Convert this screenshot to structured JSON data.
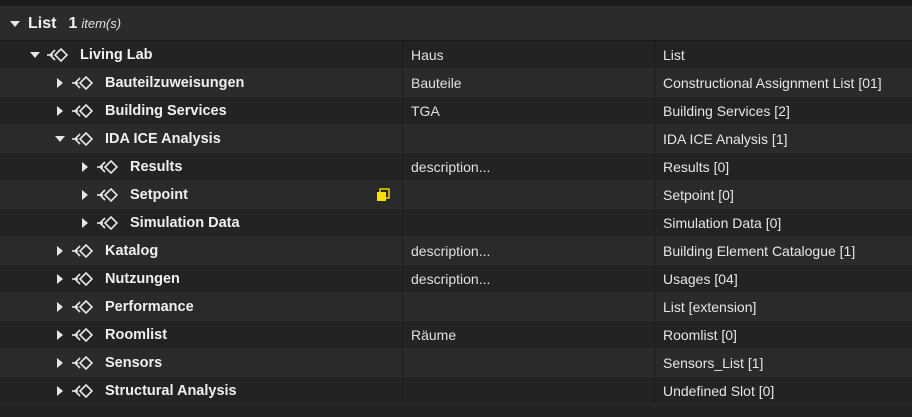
{
  "header": {
    "title": "List",
    "count": "1",
    "unit": "item(s)"
  },
  "rows": [
    {
      "label": "Living Lab",
      "desc": "Haus",
      "type": "List",
      "depth": 0,
      "expanded": true
    },
    {
      "label": "Bauteilzuweisungen",
      "desc": "Bauteile",
      "type": "Constructional Assignment List [01]",
      "depth": 1,
      "expanded": false
    },
    {
      "label": "Building Services",
      "desc": "TGA",
      "type": "Building Services [2]",
      "depth": 1,
      "expanded": false
    },
    {
      "label": "IDA ICE Analysis",
      "desc": "",
      "type": "IDA ICE Analysis [1]",
      "depth": 1,
      "expanded": true
    },
    {
      "label": "Results",
      "desc": "description...",
      "type": "Results [0]",
      "depth": 2,
      "expanded": false
    },
    {
      "label": "Setpoint",
      "desc": "",
      "type": "Setpoint [0]",
      "depth": 2,
      "expanded": false,
      "flag": true
    },
    {
      "label": "Simulation Data",
      "desc": "",
      "type": "Simulation Data [0]",
      "depth": 2,
      "expanded": false
    },
    {
      "label": "Katalog",
      "desc": "description...",
      "type": "Building Element Catalogue [1]",
      "depth": 1,
      "expanded": false
    },
    {
      "label": "Nutzungen",
      "desc": "description...",
      "type": "Usages [04]",
      "depth": 1,
      "expanded": false
    },
    {
      "label": "Performance",
      "desc": "",
      "type": "List [extension]",
      "depth": 1,
      "expanded": false
    },
    {
      "label": "Roomlist",
      "desc": "Räume",
      "type": "Roomlist [0]",
      "depth": 1,
      "expanded": false
    },
    {
      "label": "Sensors",
      "desc": "",
      "type": "Sensors_List [1]",
      "depth": 1,
      "expanded": false
    },
    {
      "label": "Structural Analysis",
      "desc": "",
      "type": "Undefined Slot [0]",
      "depth": 1,
      "expanded": false
    }
  ],
  "colors": {
    "flag": "#f5e000",
    "background": "#232323",
    "alt_row": "#2a2a2a"
  }
}
